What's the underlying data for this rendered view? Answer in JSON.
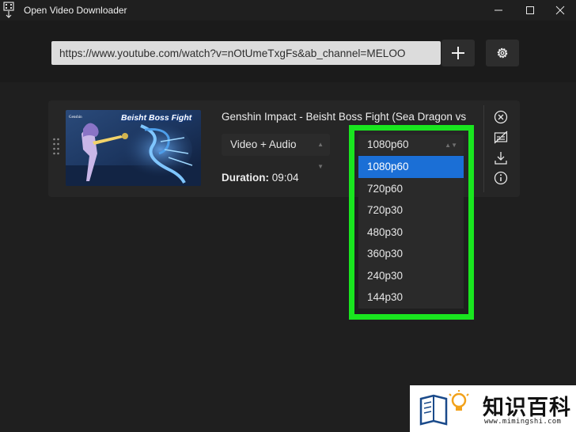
{
  "window": {
    "title": "Open Video Downloader",
    "controls": [
      "minimize",
      "maximize",
      "close"
    ]
  },
  "topbar": {
    "url_value": "https://www.youtube.com/watch?v=nOtUmeTxgFs&ab_channel=MELOO",
    "add_icon": "plus-icon",
    "settings_icon": "gear-icon"
  },
  "video": {
    "thumbnail_text": "Beisht Boss Fight",
    "thumbnail_logo": "Genshin",
    "title": "Genshin Impact - Beisht Boss Fight (Sea Dragon vs Shogun)",
    "format_selected": "Video + Audio",
    "quality_selected": "1080p60",
    "duration_label": "Duration:",
    "duration_value": "09:04",
    "actions": [
      "close-circle-icon",
      "subtitles-off-icon",
      "download-icon",
      "info-icon"
    ]
  },
  "quality_options": [
    "1080p60",
    "720p60",
    "720p30",
    "480p30",
    "360p30",
    "240p30",
    "144p30"
  ],
  "colors": {
    "highlight": "#19e61f",
    "selected_item": "#1b6fd6",
    "background": "#1f1f1f"
  },
  "watermark": {
    "text": "知识百科",
    "url": "www.mimingshi.com"
  }
}
